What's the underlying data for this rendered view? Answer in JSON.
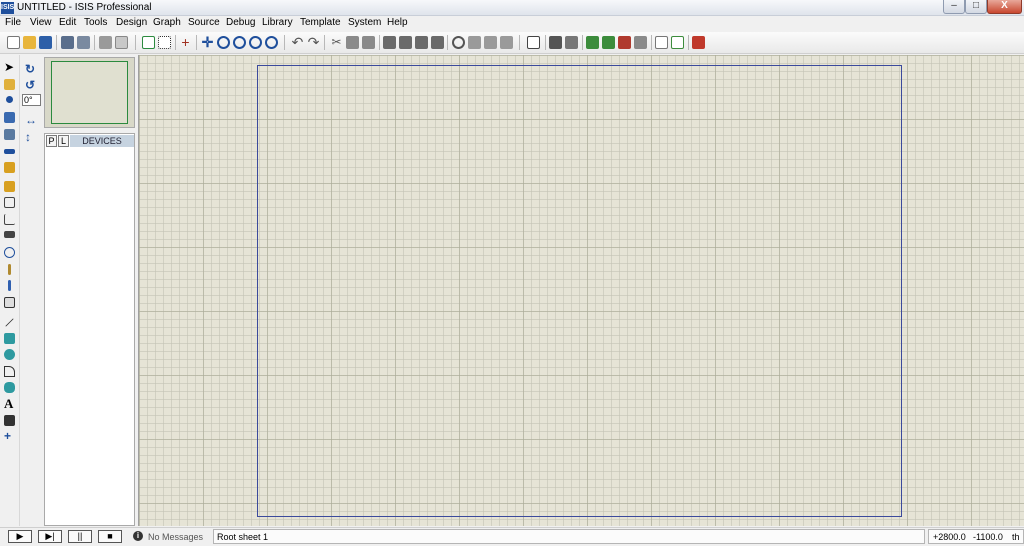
{
  "window": {
    "app_icon_text": "ISIS",
    "title": "UNTITLED - ISIS Professional",
    "minimize": "–",
    "maximize": "□",
    "close": "X"
  },
  "menu": [
    "File",
    "View",
    "Edit",
    "Tools",
    "Design",
    "Graph",
    "Source",
    "Debug",
    "Library",
    "Template",
    "System",
    "Help"
  ],
  "toolbar": {
    "icons": [
      "new-file",
      "open-file",
      "save",
      "import-section",
      "export-section",
      "print",
      "area",
      "refresh",
      "toggle-grid",
      "toggle-origin",
      "pan",
      "zoom-in",
      "zoom-out",
      "zoom-all",
      "zoom-area",
      "undo",
      "redo",
      "cut",
      "copy",
      "paste",
      "block-copy",
      "block-move",
      "block-rotate",
      "block-delete",
      "pick-device",
      "make-device",
      "packaging-tool",
      "decompose",
      "wire-autorouter",
      "search-tag",
      "property-tool",
      "design-explorer",
      "new-sheet",
      "remove-sheet",
      "goto-child",
      "bill-of-materials",
      "electrical-rule-check",
      "netlist-to-ares"
    ]
  },
  "left_tools": [
    "selection-mode",
    "component-mode",
    "junction-dot",
    "wire-label",
    "text-script",
    "bus",
    "subcircuit",
    "terminals",
    "device-pins",
    "graph",
    "tape-recorder",
    "generator",
    "voltage-probe",
    "current-probe",
    "virtual-instruments",
    "line-2d",
    "box-2d",
    "circle-2d",
    "arc-2d",
    "path-2d",
    "text-2d",
    "symbol-2d",
    "marker-2d"
  ],
  "rotation": {
    "rotate_cw": "↻",
    "rotate_ccw": "↺",
    "angle": "0°",
    "mirror_x": "↔",
    "mirror_y": "↕"
  },
  "object_selector": {
    "tab_p": "P",
    "tab_l": "L",
    "header": "DEVICES"
  },
  "status": {
    "sim_play": "▶",
    "sim_step": "▶|",
    "sim_pause": "||",
    "sim_stop": "■",
    "message_icon": "i",
    "messages": "No Messages",
    "sheet": "Root sheet 1",
    "coord_x": "+2800.0",
    "coord_y": "-1100.0",
    "unit": "th"
  }
}
